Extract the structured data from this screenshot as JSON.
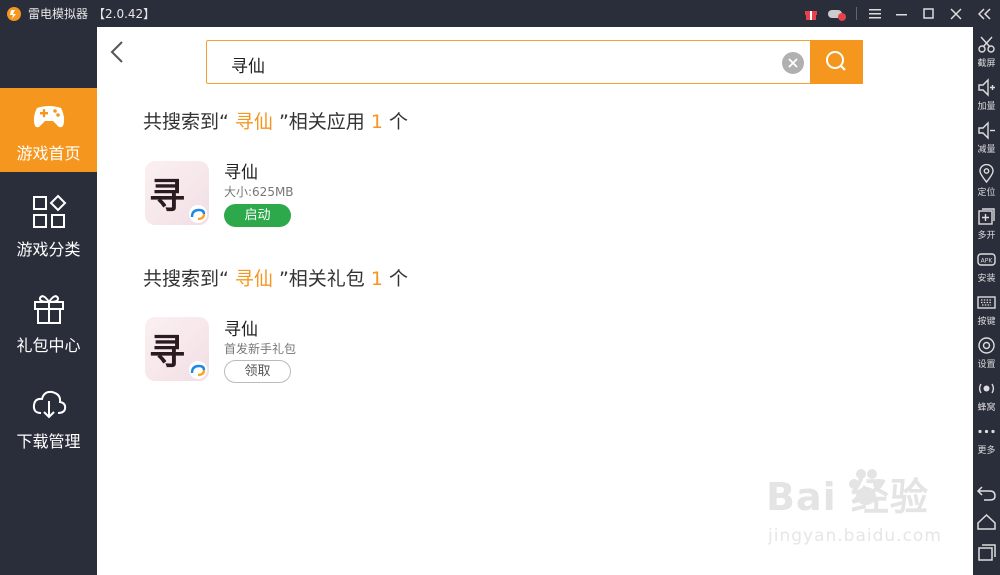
{
  "titlebar": {
    "title": "雷电模拟器",
    "version": "【2.0.42】"
  },
  "leftnav": {
    "items": [
      {
        "label": "游戏首页",
        "icon": "gamepad-icon",
        "active": true
      },
      {
        "label": "游戏分类",
        "icon": "category-grid-icon",
        "active": false
      },
      {
        "label": "礼包中心",
        "icon": "gift-icon",
        "active": false
      },
      {
        "label": "下载管理",
        "icon": "cloud-download-icon",
        "active": false
      }
    ]
  },
  "rightbar": {
    "items": [
      {
        "label": "截屏",
        "icon": "scissors-icon"
      },
      {
        "label": "加量",
        "icon": "volume-up-icon"
      },
      {
        "label": "减量",
        "icon": "volume-down-icon"
      },
      {
        "label": "定位",
        "icon": "location-pin-icon"
      },
      {
        "label": "多开",
        "icon": "multi-instance-icon"
      },
      {
        "label": "安装",
        "icon": "apk-install-icon"
      },
      {
        "label": "按键",
        "icon": "keyboard-icon"
      },
      {
        "label": "设置",
        "icon": "gear-icon"
      },
      {
        "label": "蜂窝",
        "icon": "cellular-icon"
      },
      {
        "label": "更多",
        "icon": "more-dots-icon"
      }
    ]
  },
  "search": {
    "value": "寻仙"
  },
  "apps_section": {
    "prefix": "共搜索到“ ",
    "keyword": "寻仙",
    "middle": " ”相关应用 ",
    "count": "1",
    "suffix": " 个"
  },
  "app_item": {
    "name": "寻仙",
    "size": "大小:625MB",
    "button": "启动"
  },
  "gifts_section": {
    "prefix": "共搜索到“ ",
    "keyword": "寻仙",
    "middle": " ”相关礼包 ",
    "count": "1",
    "suffix": " 个"
  },
  "gift_item": {
    "name": "寻仙",
    "desc": "首发新手礼包",
    "button": "领取"
  },
  "watermark": {
    "brand": "Bai  经验",
    "url": "jingyan.baidu.com"
  },
  "colors": {
    "accent": "#f5961e",
    "sidebar": "#2a2d3a",
    "launch": "#2da84a"
  }
}
